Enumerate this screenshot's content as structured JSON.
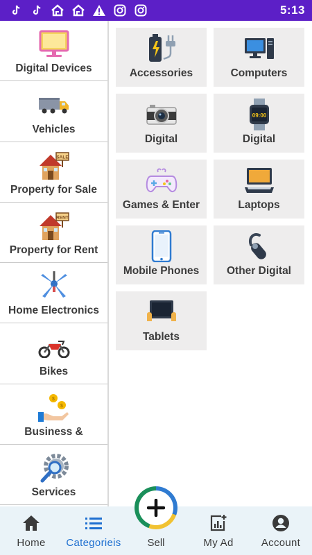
{
  "status_bar": {
    "time": "5:13",
    "icons": [
      "tiktok-icon",
      "tiktok-icon",
      "home-notification-icon",
      "home-notification-icon",
      "warning-icon",
      "instagram-icon",
      "instagram-icon"
    ],
    "background": "#5c1fc7"
  },
  "categories": [
    {
      "label": "Digital Devices",
      "icon": "monitor-icon"
    },
    {
      "label": "Vehicles",
      "icon": "truck-icon"
    },
    {
      "label": "Property for Sale",
      "icon": "house-sale-icon"
    },
    {
      "label": "Property for Rent",
      "icon": "house-rent-icon"
    },
    {
      "label": "Home Electronics",
      "icon": "ceiling-fan-icon"
    },
    {
      "label": "Bikes",
      "icon": "motorbike-icon"
    },
    {
      "label": "Business &",
      "icon": "hand-coins-icon"
    },
    {
      "label": "Services",
      "icon": "gear-search-icon"
    }
  ],
  "subcategories": [
    {
      "label": "Accessories",
      "icon": "battery-plug-icon"
    },
    {
      "label": "Computers",
      "icon": "desktop-computer-icon"
    },
    {
      "label": "Digital",
      "icon": "camera-icon"
    },
    {
      "label": "Digital",
      "icon": "smartwatch-icon",
      "watch_time": "09:00"
    },
    {
      "label": "Games & Enter",
      "icon": "gamepad-icon"
    },
    {
      "label": "Laptops",
      "icon": "laptop-icon"
    },
    {
      "label": "Mobile Phones",
      "icon": "smartphone-icon"
    },
    {
      "label": "Other Digital",
      "icon": "bluetooth-headset-icon"
    },
    {
      "label": "Tablets",
      "icon": "tablet-icon"
    }
  ],
  "bottom_nav": {
    "home": "Home",
    "categories": "Categorieis",
    "sell": "Sell",
    "my_ad": "My Ad",
    "account": "Account",
    "active": "categories",
    "active_color": "#1e6fd0"
  }
}
